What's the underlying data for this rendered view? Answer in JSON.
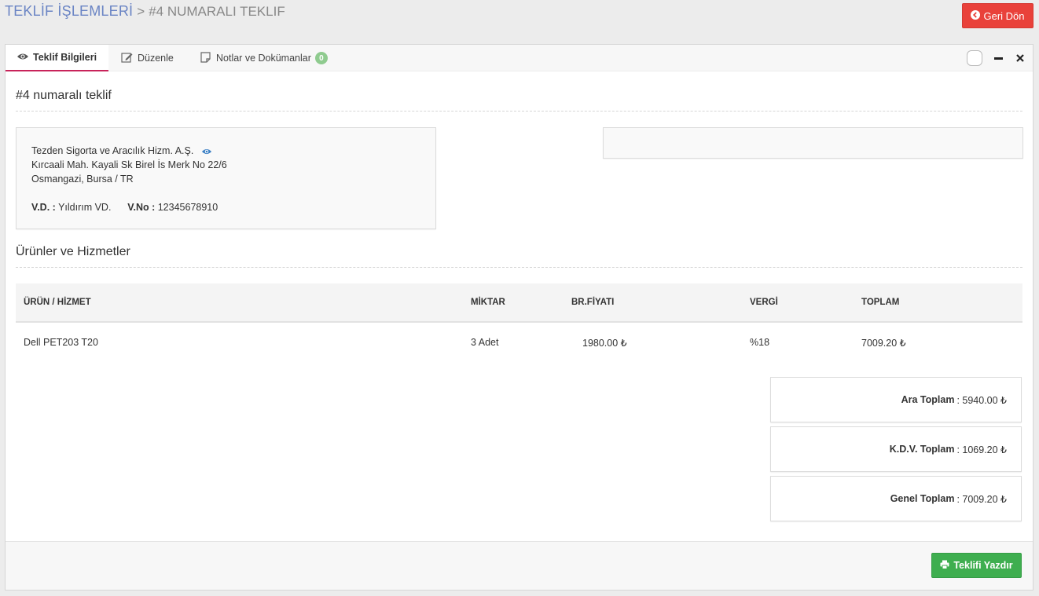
{
  "header": {
    "breadcrumb_root": "TEKLİF İŞLEMLERİ",
    "separator": ">",
    "current": "#4 NUMARALI TEKLIF",
    "back_label": "Geri Dön"
  },
  "tabs": [
    {
      "label": "Teklif Bilgileri",
      "icon": "eye-icon",
      "active": true
    },
    {
      "label": "Düzenle",
      "icon": "edit-icon",
      "active": false
    },
    {
      "label": "Notlar ve Dokümanlar",
      "icon": "note-icon",
      "badge": "0",
      "active": false
    }
  ],
  "offer": {
    "title": "#4 numaralı teklif",
    "company": "Tezden Sigorta ve Aracılık Hizm. A.Ş.",
    "address_line1": "Kırcaali Mah. Kayali Sk Birel İs Merk No 22/6",
    "address_line2": "Osmangazi, Bursa / TR",
    "vd_label": "V.D. :",
    "vd_value": "Yıldırım VD.",
    "vno_label": "V.No :",
    "vno_value": "12345678910"
  },
  "products": {
    "title": "Ürünler ve Hizmetler",
    "columns": [
      "ÜRÜN / HİZMET",
      "MİKTAR",
      "BR.FİYATI",
      "VERGİ",
      "TOPLAM"
    ],
    "rows": [
      {
        "name": "Dell PET203 T20",
        "qty": "3 Adet",
        "price": "1980.00 ₺",
        "tax": "%18",
        "total": "7009.20 ₺"
      }
    ]
  },
  "totals": {
    "subtotal_label": "Ara Toplam",
    "subtotal_value": ": 5940.00 ₺",
    "kdv_label": "K.D.V. Toplam",
    "kdv_value": ": 1069.20 ₺",
    "grand_label": "Genel Toplam",
    "grand_value": ": 7009.20 ₺"
  },
  "footer": {
    "print_label": "Teklifi Yazdır"
  },
  "colors": {
    "accent_tab": "#c8235a",
    "danger": "#e9413a",
    "success": "#3eae4f",
    "link": "#6a84c4"
  }
}
